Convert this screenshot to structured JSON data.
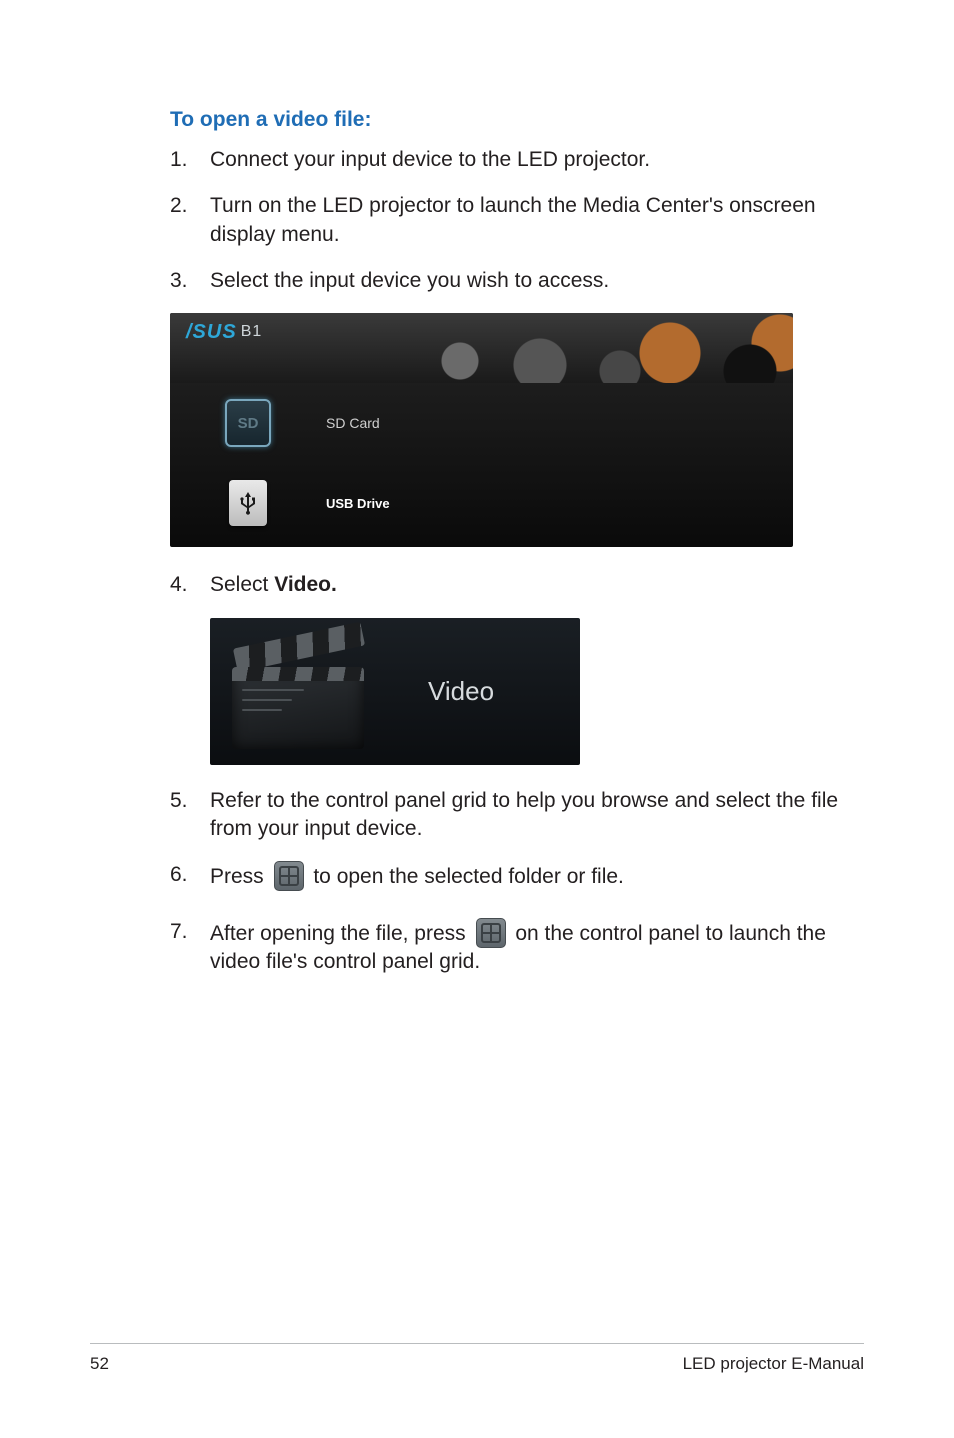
{
  "heading": "To open a video file:",
  "steps": {
    "s1": {
      "num": "1.",
      "text": "Connect your input device to the LED projector."
    },
    "s2": {
      "num": "2.",
      "text": "Turn on the LED projector to launch the Media Center's onscreen display menu."
    },
    "s3": {
      "num": "3.",
      "text": "Select the input device you wish to access."
    },
    "s4": {
      "num": "4.",
      "text_before": "Select ",
      "bold": "Video."
    },
    "s5": {
      "num": "5.",
      "text": "Refer to the control panel grid to help you browse and select the file from your input device."
    },
    "s6": {
      "num": "6.",
      "before": "Press ",
      "after": " to open the selected folder or file."
    },
    "s7": {
      "num": "7.",
      "before": "After opening the file, press ",
      "mid": " on the control panel to launch the video file's control panel grid."
    }
  },
  "screenshot1": {
    "brand_prefix": "/SUS",
    "brand_model": "B1",
    "sd_icon_text": "SD",
    "sd_label": "SD Card",
    "usb_label": "USB Drive"
  },
  "screenshot2": {
    "label": "Video"
  },
  "footer": {
    "page": "52",
    "title": "LED projector E-Manual"
  }
}
